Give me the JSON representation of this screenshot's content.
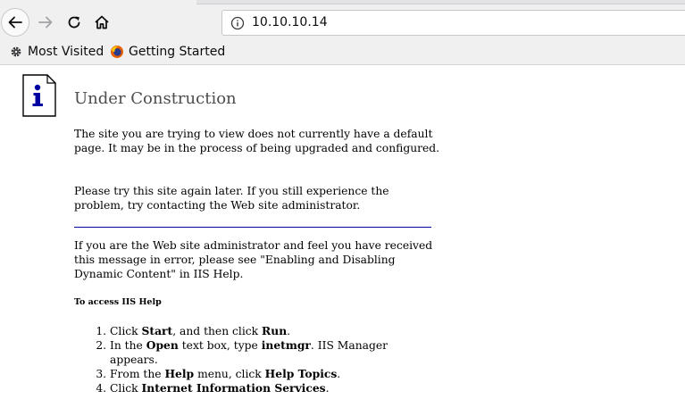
{
  "browser": {
    "url": "10.10.10.14",
    "bookmarks": [
      {
        "label": "Most Visited",
        "icon": "gear-icon"
      },
      {
        "label": "Getting Started",
        "icon": "firefox-icon"
      }
    ]
  },
  "page": {
    "title": "Under Construction",
    "paragraph1": "The site you are trying to view does not currently have a default page. It may be in the process of being upgraded and configured.",
    "paragraph2": "Please try this site again later. If you still experience the problem, try contacting the Web site administrator.",
    "paragraph3": "If you are the Web site administrator and feel you have received this message in error, please see \"Enabling and Disabling Dynamic Content\" in IIS Help.",
    "help_heading": "To access IIS Help",
    "steps": [
      {
        "t1": "Click ",
        "b1": "Start",
        "t2": ", and then click ",
        "b2": "Run",
        "t3": "."
      },
      {
        "t1": "In the ",
        "b1": "Open",
        "t2": " text box, type ",
        "b2": "inetmgr",
        "t3": ". IIS Manager appears."
      },
      {
        "t1": "From the ",
        "b1": "Help",
        "t2": " menu, click ",
        "b2": "Help Topics",
        "t3": "."
      },
      {
        "t1": "Click ",
        "b1": "Internet Information Services",
        "t2": ".",
        "b2": "",
        "t3": ""
      }
    ]
  },
  "colors": {
    "rule": "#0000a0",
    "heading": "#4d4d4d",
    "toolbar": "#f0f0f1"
  }
}
